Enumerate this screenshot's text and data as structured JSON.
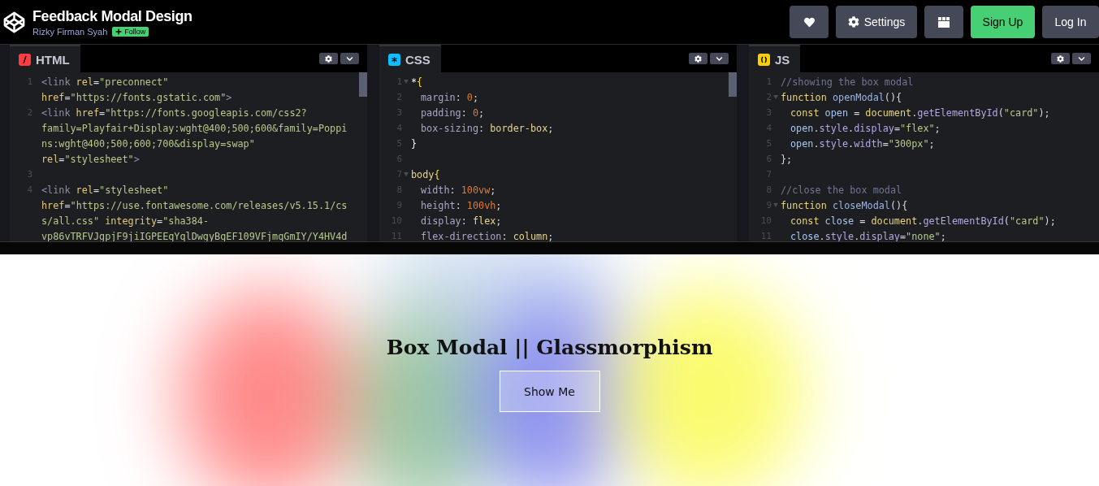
{
  "header": {
    "title": "Feedback Modal Design",
    "author": "Rizky Firman Syah",
    "follow_label": "Follow",
    "buttons": [
      {
        "kind": "heart"
      },
      {
        "kind": "settings",
        "label": "Settings"
      },
      {
        "kind": "layout"
      },
      {
        "kind": "signup",
        "label": "Sign Up"
      },
      {
        "kind": "login",
        "label": "Log In"
      }
    ]
  },
  "editors": [
    {
      "kind": "html",
      "label": "HTML",
      "scrollbar": true,
      "lines": [
        {
          "number": "1",
          "fold": false,
          "indented": false,
          "rows": [
            {
              "tokens": [
                {
                  "kind": "tag",
                  "text": "<link"
                },
                {
                  "kind": "attr",
                  "text": " rel"
                },
                {
                  "kind": "punct",
                  "text": "="
                },
                {
                  "kind": "str",
                  "text": "\"preconnect\""
                }
              ]
            },
            {
              "tokens": [
                {
                  "kind": "attr",
                  "text": "href"
                },
                {
                  "kind": "punct",
                  "text": "="
                },
                {
                  "kind": "str",
                  "text": "\"https://fonts.gstatic.com\""
                },
                {
                  "kind": "tag",
                  "text": ">"
                }
              ]
            }
          ]
        },
        {
          "number": "2",
          "fold": false,
          "indented": false,
          "rows": [
            {
              "tokens": [
                {
                  "kind": "tag",
                  "text": "<link"
                },
                {
                  "kind": "attr",
                  "text": " href"
                },
                {
                  "kind": "punct",
                  "text": "="
                },
                {
                  "kind": "str",
                  "text": "\"https://fonts.googleapis.com/css2?"
                }
              ]
            },
            {
              "tokens": [
                {
                  "kind": "str",
                  "text": "family=Playfair+Display:wght@400;500;600&family=Poppi"
                }
              ]
            },
            {
              "tokens": [
                {
                  "kind": "str",
                  "text": "ns:wght@400;500;600;700&display=swap\""
                }
              ]
            },
            {
              "tokens": [
                {
                  "kind": "attr",
                  "text": "rel"
                },
                {
                  "kind": "punct",
                  "text": "="
                },
                {
                  "kind": "str",
                  "text": "\"stylesheet\""
                },
                {
                  "kind": "tag",
                  "text": ">"
                }
              ]
            }
          ]
        },
        {
          "number": "3",
          "fold": false,
          "rows": [
            {
              "tokens": []
            }
          ]
        },
        {
          "number": "4",
          "fold": false,
          "indented": false,
          "rows": [
            {
              "tokens": [
                {
                  "kind": "tag",
                  "text": "<link"
                },
                {
                  "kind": "attr",
                  "text": " rel"
                },
                {
                  "kind": "punct",
                  "text": "="
                },
                {
                  "kind": "str",
                  "text": "\"stylesheet\""
                }
              ]
            },
            {
              "tokens": [
                {
                  "kind": "attr",
                  "text": "href"
                },
                {
                  "kind": "punct",
                  "text": "="
                },
                {
                  "kind": "str",
                  "text": "\"https://use.fontawesome.com/releases/v5.15.1/cs"
                }
              ]
            },
            {
              "tokens": [
                {
                  "kind": "str",
                  "text": "s/all.css\""
                },
                {
                  "kind": "attr",
                  "text": " integrity"
                },
                {
                  "kind": "punct",
                  "text": "="
                },
                {
                  "kind": "str",
                  "text": "\"sha384-"
                }
              ]
            },
            {
              "tokens": [
                {
                  "kind": "str",
                  "text": "vp86vTRFVJgpjF9jiIGPEEqYqlDwgyBgEF109VFjmqGmIY/Y4HV4d"
                }
              ]
            }
          ]
        }
      ]
    },
    {
      "kind": "css",
      "label": "CSS",
      "scrollbar": true,
      "lines": [
        {
          "number": "1",
          "fold": true,
          "indented": false,
          "rows": [
            {
              "tokens": [
                {
                  "kind": "sel",
                  "text": "*"
                },
                {
                  "kind": "brace",
                  "text": "{"
                }
              ]
            }
          ]
        },
        {
          "number": "2",
          "fold": false,
          "indented": true,
          "rows": [
            {
              "tokens": [
                {
                  "kind": "prop",
                  "text": "margin"
                },
                {
                  "kind": "punct",
                  "text": ": "
                },
                {
                  "kind": "num",
                  "text": "0"
                },
                {
                  "kind": "punct",
                  "text": ";"
                }
              ]
            }
          ]
        },
        {
          "number": "3",
          "fold": false,
          "indented": true,
          "rows": [
            {
              "tokens": [
                {
                  "kind": "prop",
                  "text": "padding"
                },
                {
                  "kind": "punct",
                  "text": ": "
                },
                {
                  "kind": "num",
                  "text": "0"
                },
                {
                  "kind": "punct",
                  "text": ";"
                }
              ]
            }
          ]
        },
        {
          "number": "4",
          "fold": false,
          "indented": true,
          "rows": [
            {
              "tokens": [
                {
                  "kind": "prop",
                  "text": "box-sizing"
                },
                {
                  "kind": "punct",
                  "text": ": "
                },
                {
                  "kind": "value",
                  "text": "border-box"
                },
                {
                  "kind": "punct",
                  "text": ";"
                }
              ]
            }
          ]
        },
        {
          "number": "5",
          "fold": false,
          "indented": false,
          "rows": [
            {
              "tokens": [
                {
                  "kind": "sel",
                  "text": "}"
                }
              ]
            }
          ]
        },
        {
          "number": "6",
          "fold": false,
          "rows": [
            {
              "tokens": []
            }
          ]
        },
        {
          "number": "7",
          "fold": true,
          "indented": false,
          "rows": [
            {
              "tokens": [
                {
                  "kind": "value",
                  "text": "body"
                },
                {
                  "kind": "brace",
                  "text": "{"
                }
              ]
            }
          ]
        },
        {
          "number": "8",
          "fold": false,
          "indented": true,
          "rows": [
            {
              "tokens": [
                {
                  "kind": "prop",
                  "text": "width"
                },
                {
                  "kind": "punct",
                  "text": ": "
                },
                {
                  "kind": "num",
                  "text": "100vw"
                },
                {
                  "kind": "punct",
                  "text": ";"
                }
              ]
            }
          ]
        },
        {
          "number": "9",
          "fold": false,
          "indented": true,
          "rows": [
            {
              "tokens": [
                {
                  "kind": "prop",
                  "text": "height"
                },
                {
                  "kind": "punct",
                  "text": ": "
                },
                {
                  "kind": "num",
                  "text": "100vh"
                },
                {
                  "kind": "punct",
                  "text": ";"
                }
              ]
            }
          ]
        },
        {
          "number": "10",
          "fold": false,
          "indented": true,
          "rows": [
            {
              "tokens": [
                {
                  "kind": "prop",
                  "text": "display"
                },
                {
                  "kind": "punct",
                  "text": ": "
                },
                {
                  "kind": "value",
                  "text": "flex"
                },
                {
                  "kind": "punct",
                  "text": ";"
                }
              ]
            }
          ]
        },
        {
          "number": "11",
          "fold": false,
          "indented": true,
          "rows": [
            {
              "tokens": [
                {
                  "kind": "prop",
                  "text": "flex-direction"
                },
                {
                  "kind": "punct",
                  "text": ": "
                },
                {
                  "kind": "value",
                  "text": "column"
                },
                {
                  "kind": "punct",
                  "text": ";"
                }
              ]
            }
          ]
        }
      ]
    },
    {
      "kind": "js",
      "label": "JS",
      "scrollbar": false,
      "lines": [
        {
          "number": "1",
          "fold": false,
          "indented": false,
          "rows": [
            {
              "tokens": [
                {
                  "kind": "comment",
                  "text": "//showing the box modal"
                }
              ]
            }
          ]
        },
        {
          "number": "2",
          "fold": true,
          "indented": false,
          "rows": [
            {
              "tokens": [
                {
                  "kind": "kw",
                  "text": "function"
                },
                {
                  "kind": "fn",
                  "text": " openModal"
                },
                {
                  "kind": "punct",
                  "text": "(){"
                }
              ]
            }
          ]
        },
        {
          "number": "3",
          "fold": false,
          "indented": true,
          "rows": [
            {
              "tokens": [
                {
                  "kind": "kw",
                  "text": "const"
                },
                {
                  "kind": "var",
                  "text": " open"
                },
                {
                  "kind": "punct",
                  "text": " = "
                },
                {
                  "kind": "kw",
                  "text": "document"
                },
                {
                  "kind": "punct",
                  "text": "."
                },
                {
                  "kind": "method",
                  "text": "getElementById"
                },
                {
                  "kind": "punct",
                  "text": "("
                },
                {
                  "kind": "str",
                  "text": "\"card\""
                },
                {
                  "kind": "punct",
                  "text": ");"
                }
              ]
            }
          ]
        },
        {
          "number": "4",
          "fold": false,
          "indented": true,
          "rows": [
            {
              "tokens": [
                {
                  "kind": "var",
                  "text": "open"
                },
                {
                  "kind": "punct",
                  "text": "."
                },
                {
                  "kind": "method",
                  "text": "style"
                },
                {
                  "kind": "punct",
                  "text": "."
                },
                {
                  "kind": "method",
                  "text": "display"
                },
                {
                  "kind": "punct",
                  "text": "="
                },
                {
                  "kind": "str",
                  "text": "\"flex\""
                },
                {
                  "kind": "punct",
                  "text": ";"
                }
              ]
            }
          ]
        },
        {
          "number": "5",
          "fold": false,
          "indented": true,
          "rows": [
            {
              "tokens": [
                {
                  "kind": "var",
                  "text": "open"
                },
                {
                  "kind": "punct",
                  "text": "."
                },
                {
                  "kind": "method",
                  "text": "style"
                },
                {
                  "kind": "punct",
                  "text": "."
                },
                {
                  "kind": "method",
                  "text": "width"
                },
                {
                  "kind": "punct",
                  "text": "="
                },
                {
                  "kind": "str",
                  "text": "\"300px\""
                },
                {
                  "kind": "punct",
                  "text": ";"
                }
              ]
            }
          ]
        },
        {
          "number": "6",
          "fold": false,
          "indented": false,
          "rows": [
            {
              "tokens": [
                {
                  "kind": "punct",
                  "text": "};"
                }
              ]
            }
          ]
        },
        {
          "number": "7",
          "fold": false,
          "rows": [
            {
              "tokens": []
            }
          ]
        },
        {
          "number": "8",
          "fold": false,
          "indented": false,
          "rows": [
            {
              "tokens": [
                {
                  "kind": "comment",
                  "text": "//close the box modal"
                }
              ]
            }
          ]
        },
        {
          "number": "9",
          "fold": true,
          "indented": false,
          "rows": [
            {
              "tokens": [
                {
                  "kind": "kw",
                  "text": "function"
                },
                {
                  "kind": "fn",
                  "text": " closeModal"
                },
                {
                  "kind": "punct",
                  "text": "(){"
                }
              ]
            }
          ]
        },
        {
          "number": "10",
          "fold": false,
          "indented": true,
          "rows": [
            {
              "tokens": [
                {
                  "kind": "kw",
                  "text": "const"
                },
                {
                  "kind": "var",
                  "text": " close"
                },
                {
                  "kind": "punct",
                  "text": " = "
                },
                {
                  "kind": "kw",
                  "text": "document"
                },
                {
                  "kind": "punct",
                  "text": "."
                },
                {
                  "kind": "method",
                  "text": "getElementById"
                },
                {
                  "kind": "punct",
                  "text": "("
                },
                {
                  "kind": "str",
                  "text": "\"card\""
                },
                {
                  "kind": "punct",
                  "text": ");"
                }
              ]
            }
          ]
        },
        {
          "number": "11",
          "fold": false,
          "indented": true,
          "rows": [
            {
              "tokens": [
                {
                  "kind": "var",
                  "text": "close"
                },
                {
                  "kind": "punct",
                  "text": "."
                },
                {
                  "kind": "method",
                  "text": "style"
                },
                {
                  "kind": "punct",
                  "text": "."
                },
                {
                  "kind": "method",
                  "text": "display"
                },
                {
                  "kind": "punct",
                  "text": "="
                },
                {
                  "kind": "str",
                  "text": "\"none\""
                },
                {
                  "kind": "punct",
                  "text": ";"
                }
              ]
            }
          ]
        }
      ]
    }
  ],
  "preview": {
    "title": "Box Modal || Glassmorphism",
    "button": "Show Me"
  }
}
